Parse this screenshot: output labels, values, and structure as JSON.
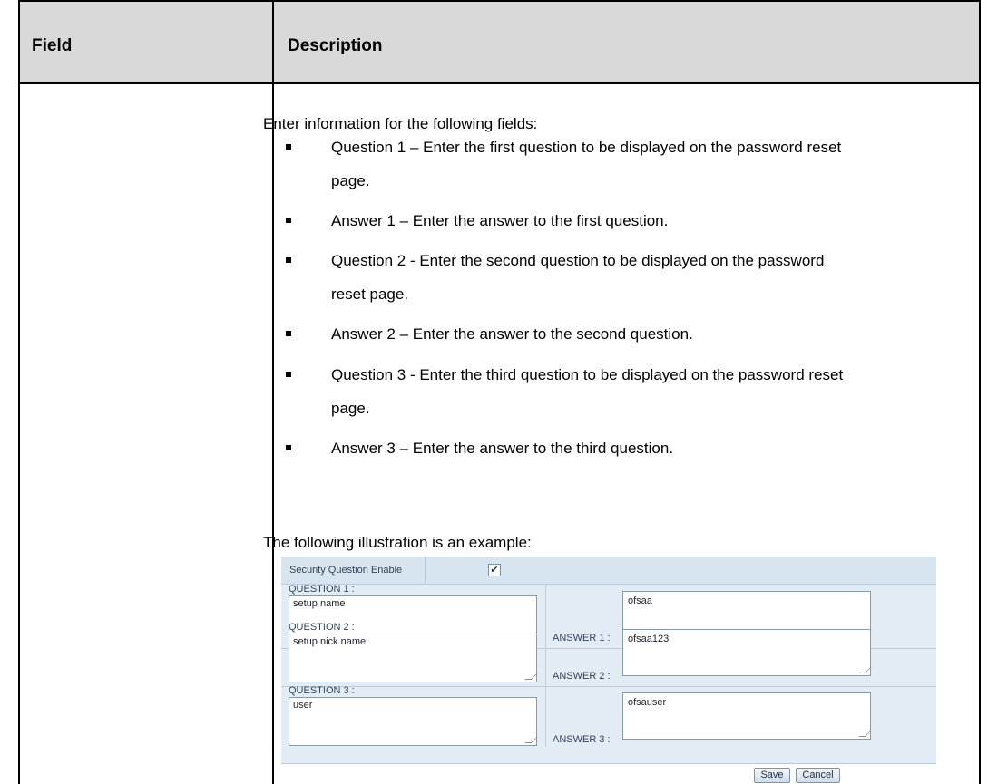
{
  "table": {
    "header_field": "Field",
    "header_description": "Description"
  },
  "description": {
    "intro": "Enter information for the following fields:",
    "bullets": [
      {
        "line1": "Question 1 – Enter the first question to be displayed on the password reset",
        "line2": "page."
      },
      {
        "line1": "Answer 1 – Enter the answer to the first question.",
        "line2": ""
      },
      {
        "line1": "Question 2 - Enter the second question to be displayed on the password",
        "line2": "reset page."
      },
      {
        "line1": "Answer 2 – Enter the answer to the second question.",
        "line2": ""
      },
      {
        "line1": "Question 3 - Enter the third question to be displayed on the password reset",
        "line2": "page."
      },
      {
        "line1": "Answer 3 – Enter the answer to the third question.",
        "line2": ""
      }
    ],
    "example_caption": "The following illustration is an example:"
  },
  "illustration": {
    "security_question_label": "Security Question Enable",
    "security_question_checked": true,
    "checkmark_glyph": "✔",
    "rows": [
      {
        "question_label": "QUESTION 1 :",
        "question_value": "setup name",
        "answer_label": "ANSWER 1 :",
        "answer_value": "ofsaa"
      },
      {
        "question_label": "QUESTION 2 :",
        "question_value": "setup nick name",
        "answer_label": "ANSWER 2 :",
        "answer_value": "ofsaa123"
      },
      {
        "question_label": "QUESTION 3 :",
        "question_value": "user",
        "answer_label": "ANSWER 3 :",
        "answer_value": "ofsauser"
      }
    ],
    "save_label": "Save",
    "cancel_label": "Cancel"
  }
}
